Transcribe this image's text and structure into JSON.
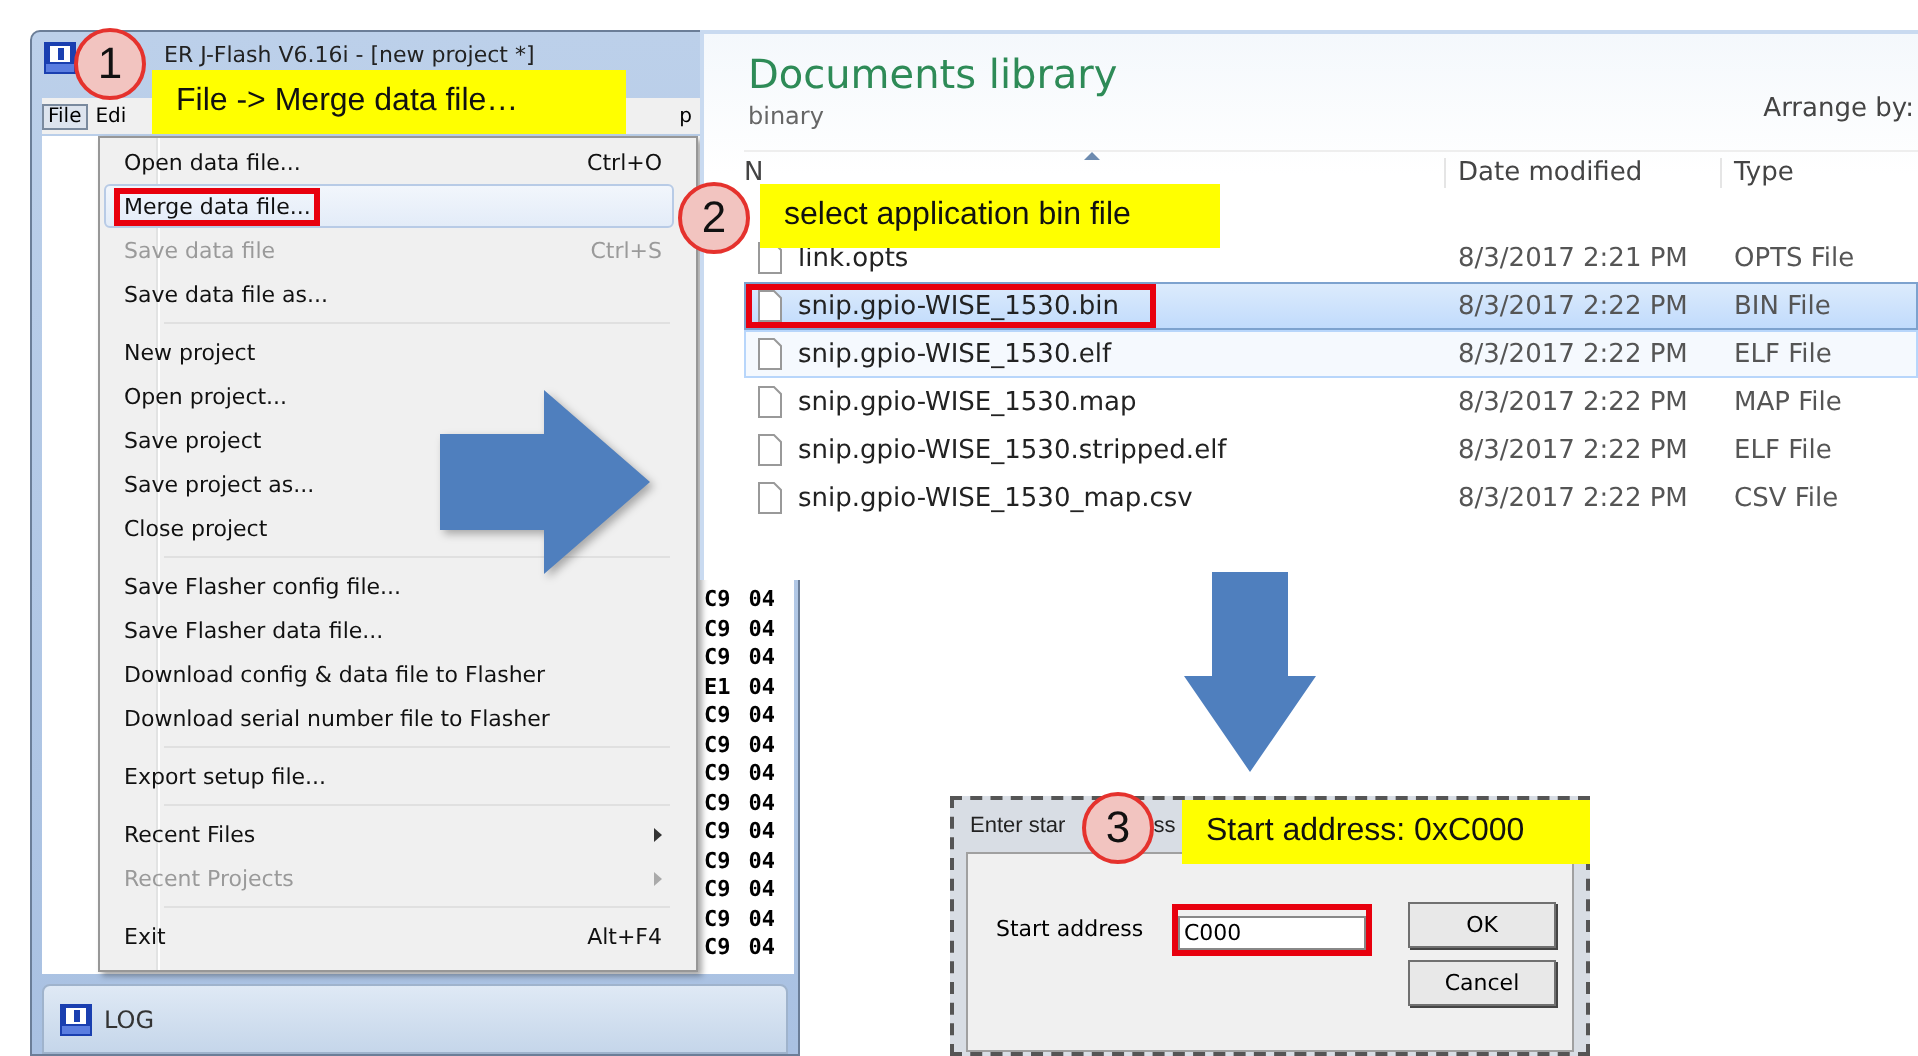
{
  "jflash_window": {
    "title": "ER J-Flash V6.16i - [new project *]",
    "menu_bar": [
      {
        "label": "File",
        "selected": true
      },
      {
        "label": "Edi",
        "selected": false
      },
      {
        "label": "p",
        "selected": false
      }
    ],
    "file_menu": [
      {
        "kind": "item",
        "label": "Open data file...",
        "shortcut": "Ctrl+O",
        "disabled": false,
        "hovered": false,
        "outlined": false,
        "submenu": false
      },
      {
        "kind": "item",
        "label": "Merge data file...",
        "disabled": false,
        "hovered": true,
        "outlined": true,
        "submenu": false
      },
      {
        "kind": "item",
        "label": "Save data file",
        "shortcut": "Ctrl+S",
        "disabled": true,
        "hovered": false,
        "outlined": false,
        "submenu": false
      },
      {
        "kind": "item",
        "label": "Save data file as...",
        "disabled": false,
        "hovered": false,
        "outlined": false,
        "submenu": false
      },
      {
        "kind": "separator"
      },
      {
        "kind": "item",
        "label": "New project",
        "disabled": false,
        "hovered": false,
        "outlined": false,
        "submenu": false
      },
      {
        "kind": "item",
        "label": "Open project...",
        "disabled": false,
        "hovered": false,
        "outlined": false,
        "submenu": false
      },
      {
        "kind": "item",
        "label": "Save project",
        "disabled": false,
        "hovered": false,
        "outlined": false,
        "submenu": false
      },
      {
        "kind": "item",
        "label": "Save project as...",
        "disabled": false,
        "hovered": false,
        "outlined": false,
        "submenu": false
      },
      {
        "kind": "item",
        "label": "Close project",
        "disabled": false,
        "hovered": false,
        "outlined": false,
        "submenu": false
      },
      {
        "kind": "separator"
      },
      {
        "kind": "item",
        "label": "Save Flasher config file...",
        "disabled": false,
        "hovered": false,
        "outlined": false,
        "submenu": false
      },
      {
        "kind": "item",
        "label": "Save Flasher data file...",
        "disabled": false,
        "hovered": false,
        "outlined": false,
        "submenu": false
      },
      {
        "kind": "item",
        "label": "Download config & data file to Flasher",
        "disabled": false,
        "hovered": false,
        "outlined": false,
        "submenu": false
      },
      {
        "kind": "item",
        "label": "Download serial number file to Flasher",
        "disabled": false,
        "hovered": false,
        "outlined": false,
        "submenu": false
      },
      {
        "kind": "separator"
      },
      {
        "kind": "item",
        "label": "Export setup file...",
        "disabled": false,
        "hovered": false,
        "outlined": false,
        "submenu": false
      },
      {
        "kind": "separator"
      },
      {
        "kind": "item",
        "label": "Recent Files",
        "disabled": false,
        "hovered": false,
        "outlined": false,
        "submenu": true
      },
      {
        "kind": "item",
        "label": "Recent Projects",
        "disabled": true,
        "hovered": false,
        "outlined": false,
        "submenu": true
      },
      {
        "kind": "separator"
      },
      {
        "kind": "item",
        "label": "Exit",
        "shortcut": "Alt+F4",
        "disabled": false,
        "hovered": false,
        "outlined": false,
        "submenu": false
      }
    ],
    "hex_rows": [
      [
        "C9",
        "04"
      ],
      [
        "C9",
        "04"
      ],
      [
        "C9",
        "04"
      ],
      [
        "E1",
        "04"
      ],
      [
        "C9",
        "04"
      ],
      [
        "C9",
        "04"
      ],
      [
        "C9",
        "04"
      ],
      [
        "C9",
        "04"
      ],
      [
        "C9",
        "04"
      ],
      [
        "C9",
        "04"
      ],
      [
        "C9",
        "04"
      ],
      [
        "C9",
        "04"
      ],
      [
        "C9",
        "04"
      ]
    ],
    "log_panel": {
      "title": "LOG"
    }
  },
  "explorer": {
    "title": "Documents library",
    "subtitle": "binary",
    "arrange_label": "Arrange by:",
    "columns": [
      "N",
      "Date modified",
      "Type"
    ],
    "files": [
      {
        "name": "link.opts",
        "date": "8/3/2017 2:21 PM",
        "type": "OPTS File",
        "selected": false,
        "hovered": false,
        "outlined": false
      },
      {
        "name": "snip.gpio-WISE_1530.bin",
        "date": "8/3/2017 2:22 PM",
        "type": "BIN File",
        "selected": true,
        "hovered": false,
        "outlined": true
      },
      {
        "name": "snip.gpio-WISE_1530.elf",
        "date": "8/3/2017 2:22 PM",
        "type": "ELF File",
        "selected": false,
        "hovered": true,
        "outlined": false
      },
      {
        "name": "snip.gpio-WISE_1530.map",
        "date": "8/3/2017 2:22 PM",
        "type": "MAP File",
        "selected": false,
        "hovered": false,
        "outlined": false
      },
      {
        "name": "snip.gpio-WISE_1530.stripped.elf",
        "date": "8/3/2017 2:22 PM",
        "type": "ELF File",
        "selected": false,
        "hovered": false,
        "outlined": false
      },
      {
        "name": "snip.gpio-WISE_1530_map.csv",
        "date": "8/3/2017 2:22 PM",
        "type": "CSV File",
        "selected": false,
        "hovered": false,
        "outlined": false
      }
    ]
  },
  "dialog": {
    "title_parts": [
      "Enter star",
      "ss"
    ],
    "field_label": "Start address",
    "field_value": "C000",
    "field_outlined": true,
    "buttons": [
      "OK",
      "Cancel"
    ]
  },
  "callouts": [
    {
      "number": "1",
      "text": "File -> Merge data file…"
    },
    {
      "number": "2",
      "text": "select application bin file"
    },
    {
      "number": "3",
      "text": "Start address: 0xC000"
    }
  ]
}
